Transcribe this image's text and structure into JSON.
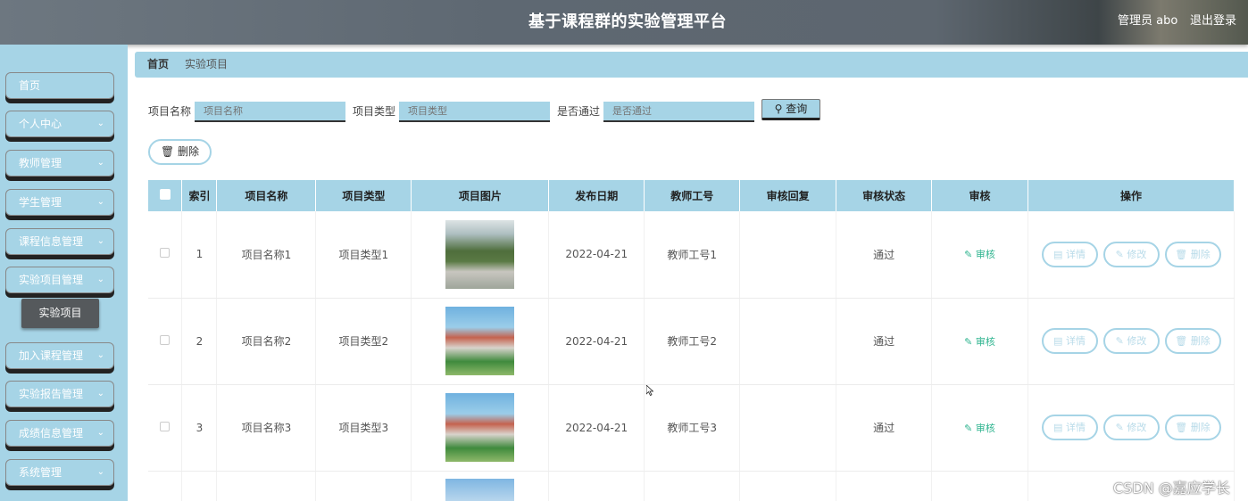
{
  "header": {
    "title": "基于课程群的实验管理平台",
    "user": "管理员 abo",
    "logout": "退出登录"
  },
  "sidebar": {
    "items": [
      {
        "label": "首页",
        "has_arrow": false
      },
      {
        "label": "个人中心",
        "has_arrow": true
      },
      {
        "label": "教师管理",
        "has_arrow": true
      },
      {
        "label": "学生管理",
        "has_arrow": true
      },
      {
        "label": "课程信息管理",
        "has_arrow": true
      },
      {
        "label": "实验项目管理",
        "has_arrow": true
      },
      {
        "label": "加入课程管理",
        "has_arrow": true
      },
      {
        "label": "实验报告管理",
        "has_arrow": true
      },
      {
        "label": "成绩信息管理",
        "has_arrow": true
      },
      {
        "label": "系统管理",
        "has_arrow": true
      }
    ],
    "sub_item": "实验项目",
    "arrow": "chevron-down-icon"
  },
  "breadcrumb": {
    "home": "首页",
    "current": "实验项目"
  },
  "search": {
    "name_label": "项目名称",
    "name_placeholder": "项目名称",
    "type_label": "项目类型",
    "type_placeholder": "项目类型",
    "pass_label": "是否通过",
    "pass_placeholder": "是否通过",
    "query_button": "查询"
  },
  "actions": {
    "delete_button": "删除"
  },
  "table": {
    "headers": [
      "索引",
      "项目名称",
      "项目类型",
      "项目图片",
      "发布日期",
      "教师工号",
      "审核回复",
      "审核状态",
      "审核",
      "操作"
    ],
    "rows": [
      {
        "index": "1",
        "name": "项目名称1",
        "type": "项目类型1",
        "date": "2022-04-21",
        "teacher_id": "教师工号1",
        "reply": "",
        "status": "通过",
        "audit": "审核"
      },
      {
        "index": "2",
        "name": "项目名称2",
        "type": "项目类型2",
        "date": "2022-04-21",
        "teacher_id": "教师工号2",
        "reply": "",
        "status": "通过",
        "audit": "审核"
      },
      {
        "index": "3",
        "name": "项目名称3",
        "type": "项目类型3",
        "date": "2022-04-21",
        "teacher_id": "教师工号3",
        "reply": "",
        "status": "通过",
        "audit": "审核"
      }
    ],
    "op_labels": {
      "detail": "详情",
      "edit": "修改",
      "delete": "删除"
    }
  },
  "watermark": "CSDN @嘉应学长",
  "colors": {
    "accent": "#a6d4e6",
    "audit_link": "#2fb48f",
    "header": "#5e6872"
  }
}
